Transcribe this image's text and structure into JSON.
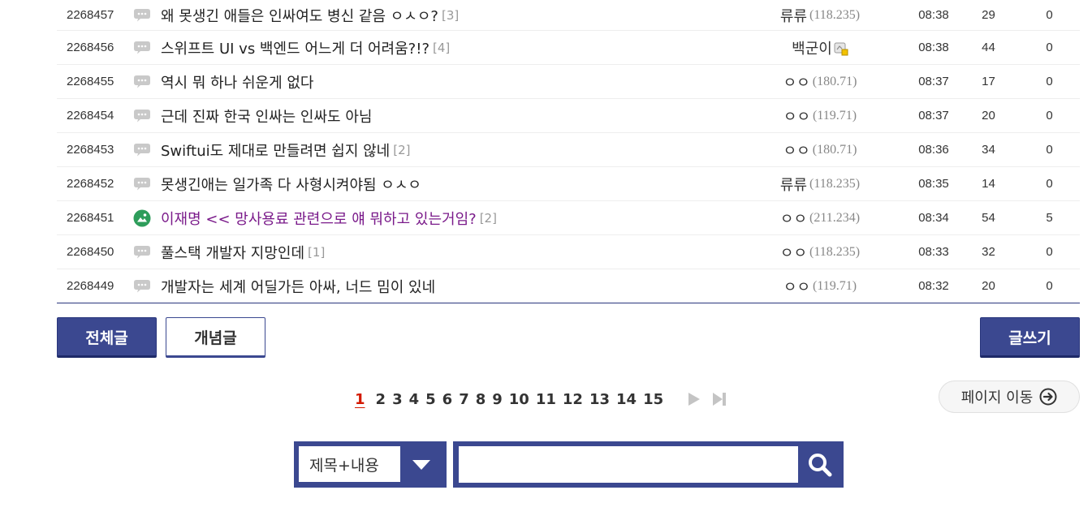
{
  "posts": [
    {
      "num": "2268457",
      "icon": "speech-bubble-icon",
      "title": "왜 못생긴 애들은 인싸여도 병신 같음 ㅇㅅㅇ?",
      "comments": "[3]",
      "writer": "류류",
      "ip": "(118.235)",
      "fixed": false,
      "date": "08:38",
      "views": "29",
      "recommend": "0",
      "highlight": false
    },
    {
      "num": "2268456",
      "icon": "speech-bubble-icon",
      "title": "스위프트 UI vs 백엔드 어느게 더 어려움?!?",
      "comments": "[4]",
      "writer": "백군이",
      "ip": "",
      "fixed": true,
      "date": "08:38",
      "views": "44",
      "recommend": "0",
      "highlight": false
    },
    {
      "num": "2268455",
      "icon": "speech-bubble-icon",
      "title": "역시 뭐 하나 쉬운게 없다",
      "comments": "",
      "writer": "ㅇㅇ",
      "ip": "(180.71)",
      "fixed": false,
      "date": "08:37",
      "views": "17",
      "recommend": "0",
      "highlight": false
    },
    {
      "num": "2268454",
      "icon": "speech-bubble-icon",
      "title": "근데 진짜 한국 인싸는 인싸도 아님",
      "comments": "",
      "writer": "ㅇㅇ",
      "ip": "(119.71)",
      "fixed": false,
      "date": "08:37",
      "views": "20",
      "recommend": "0",
      "highlight": false
    },
    {
      "num": "2268453",
      "icon": "speech-bubble-icon",
      "title": "Swiftui도 제대로 만들려면 쉽지 않네",
      "comments": "[2]",
      "writer": "ㅇㅇ",
      "ip": "(180.71)",
      "fixed": false,
      "date": "08:36",
      "views": "34",
      "recommend": "0",
      "highlight": false
    },
    {
      "num": "2268452",
      "icon": "speech-bubble-icon",
      "title": "못생긴애는 일가족 다 사형시켜야됨 ㅇㅅㅇ",
      "comments": "",
      "writer": "류류",
      "ip": "(118.235)",
      "fixed": false,
      "date": "08:35",
      "views": "14",
      "recommend": "0",
      "highlight": false
    },
    {
      "num": "2268451",
      "icon": "image-post-icon",
      "title": "이재명 << 망사용료 관련으로 얘 뭐하고 있는거임?",
      "comments": "[2]",
      "writer": "ㅇㅇ",
      "ip": "(211.234)",
      "fixed": false,
      "date": "08:34",
      "views": "54",
      "recommend": "5",
      "highlight": true
    },
    {
      "num": "2268450",
      "icon": "speech-bubble-icon",
      "title": "풀스택 개발자 지망인데",
      "comments": "[1]",
      "writer": "ㅇㅇ",
      "ip": "(118.235)",
      "fixed": false,
      "date": "08:33",
      "views": "32",
      "recommend": "0",
      "highlight": false
    },
    {
      "num": "2268449",
      "icon": "speech-bubble-icon",
      "title": "개발자는 세계 어딜가든 아싸, 너드 밈이 있네",
      "comments": "",
      "writer": "ㅇㅇ",
      "ip": "(119.71)",
      "fixed": false,
      "date": "08:32",
      "views": "20",
      "recommend": "0",
      "highlight": false
    }
  ],
  "buttons": {
    "all": "전체글",
    "concept": "개념글",
    "write": "글쓰기"
  },
  "pagination": {
    "current": "1",
    "pages": [
      "1",
      "2",
      "3",
      "4",
      "5",
      "6",
      "7",
      "8",
      "9",
      "10",
      "11",
      "12",
      "13",
      "14",
      "15"
    ]
  },
  "page_jump": "페이지 이동",
  "search": {
    "scope": "제목+내용",
    "value": ""
  },
  "colors": {
    "accent": "#3b4890",
    "current_page": "#d31900",
    "highlight_title": "#7a1a8a"
  }
}
